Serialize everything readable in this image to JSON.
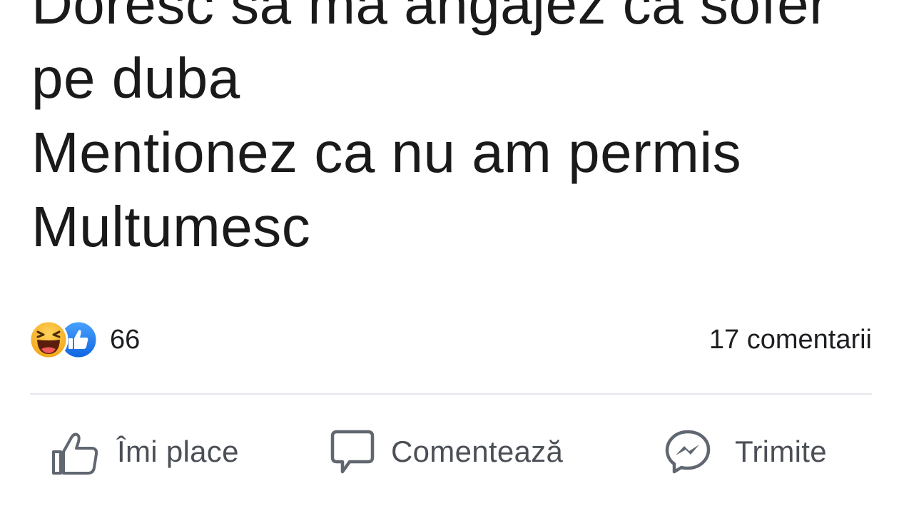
{
  "post": {
    "lines": [
      "Doresc sa ma angajez ca sofer",
      "pe duba",
      "Mentionez ca nu am permis",
      "Multumesc"
    ]
  },
  "stats": {
    "reaction_icons": [
      "haha-reaction-icon",
      "like-reaction-icon"
    ],
    "reactions_count": "66",
    "comments_count": "17 comentarii"
  },
  "actions": {
    "like_label": "Îmi place",
    "comment_label": "Comentează",
    "send_label": "Trimite"
  },
  "colors": {
    "like_blue": "#1877f2",
    "haha_yellow": "#f7b125",
    "action_gray": "#606770",
    "divider": "#e4e6eb"
  }
}
